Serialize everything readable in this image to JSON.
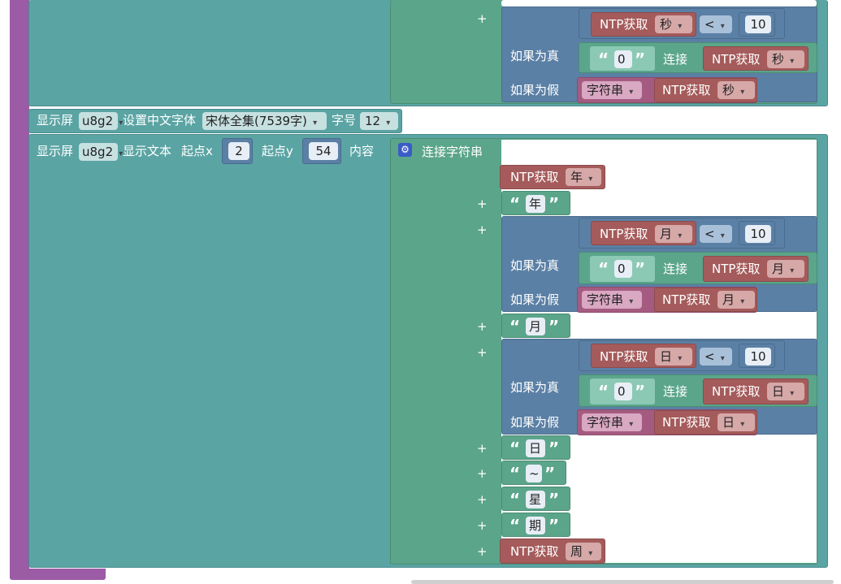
{
  "tail": {
    "row1": {
      "ntp": "NTP获取",
      "unit": "秒",
      "op": "<",
      "num": "10"
    },
    "row2": {
      "if_true": "如果为真",
      "zero": "0",
      "join": "连接",
      "ntp": "NTP获取",
      "unit": "秒"
    },
    "row3": {
      "if_false": "如果为假",
      "str": "字符串",
      "ntp": "NTP获取",
      "unit": "秒"
    }
  },
  "font_block": {
    "display": "显示屏",
    "dev": "u8g2",
    "set_font": "设置中文字体",
    "font": "宋体全集(7539字)",
    "size_label": "字号",
    "size": "12"
  },
  "text_block": {
    "display": "显示屏",
    "dev": "u8g2",
    "show_text": "显示文本",
    "x_label": "起点x",
    "x": "2",
    "y_label": "起点y",
    "y": "54",
    "content": "内容",
    "concat": "连接字符串"
  },
  "concat_items": {
    "ntp_year": {
      "ntp": "NTP获取",
      "unit": "年"
    },
    "lit_year": "年",
    "month": {
      "ntp": "NTP获取",
      "unit": "月",
      "op": "<",
      "num": "10",
      "if_true": "如果为真",
      "zero": "0",
      "join": "连接",
      "ntp2": "NTP获取",
      "unit2": "月",
      "if_false": "如果为假",
      "str": "字符串",
      "ntp3": "NTP获取",
      "unit3": "月"
    },
    "lit_month": "月",
    "day": {
      "ntp": "NTP获取",
      "unit": "日",
      "op": "<",
      "num": "10",
      "if_true": "如果为真",
      "zero": "0",
      "join": "连接",
      "ntp2": "NTP获取",
      "unit2": "日",
      "if_false": "如果为假",
      "str": "字符串",
      "ntp3": "NTP获取",
      "unit3": "日"
    },
    "lit_day": "日",
    "lit_tilde": "~",
    "lit_xing": "星",
    "lit_qi": "期",
    "ntp_week": {
      "ntp": "NTP获取",
      "unit": "周"
    }
  },
  "plus": "+",
  "open_quote": "“",
  "close_quote": "”",
  "colors": {
    "purple": "#9b5ba5",
    "teal": "#5ba4a4",
    "green": "#5ba58b",
    "blue": "#5b80a5",
    "red": "#a55b5b",
    "pink": "#a55b80"
  }
}
